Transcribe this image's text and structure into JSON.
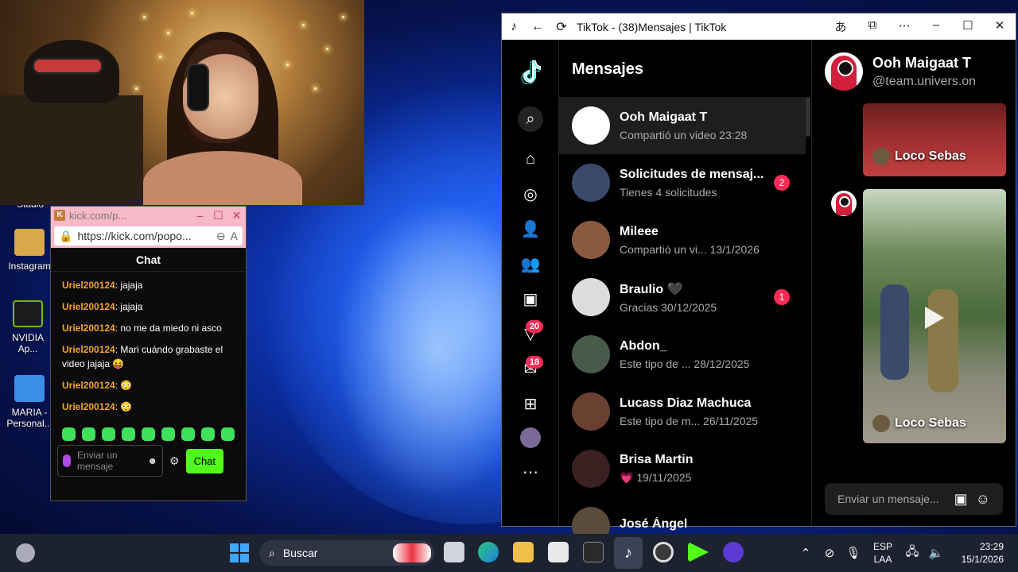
{
  "desktop": {
    "icons": [
      {
        "label": "Studio"
      },
      {
        "label": "Instagram"
      },
      {
        "label": "NVIDIA Ap..."
      },
      {
        "label": "MARIA - Personal..."
      }
    ]
  },
  "kick": {
    "tab_title": "kick.com/p...",
    "url": "https://kick.com/popo...",
    "chat_heading": "Chat",
    "messages": [
      {
        "user": "Uriel200124",
        "text": ": jajaja"
      },
      {
        "user": "Uriel200124",
        "text": ": jajaja"
      },
      {
        "user": "Uriel200124",
        "text": ": no me da miedo ni asco"
      },
      {
        "user": "Uriel200124",
        "text": ": Mari cuándo grabaste el video jajaja 😝"
      },
      {
        "user": "Uriel200124",
        "text": ": 😳"
      },
      {
        "user": "Uriel200124",
        "text": ": 😳"
      }
    ],
    "input_placeholder": "Enviar un mensaje",
    "send_label": "Chat"
  },
  "tiktok": {
    "window_title": "TikTok - (38)Mensajes | TikTok",
    "heading": "Mensajes",
    "rail_badges": {
      "activity": "20",
      "inbox": "18"
    },
    "conversations": [
      {
        "name": "Ooh Maigaat T",
        "sub": "Compartió un video 23:28",
        "count": "",
        "avatar_color": "#ffffff"
      },
      {
        "name": "Solicitudes de mensaj...",
        "sub": "Tienes 4 solicitudes",
        "count": "2",
        "avatar_color": "#3b4a6b"
      },
      {
        "name": "Mileee",
        "sub": "Compartió un vi...  13/1/2026",
        "count": "",
        "avatar_color": "#8a5a40"
      },
      {
        "name": "Braulio 🖤",
        "sub": "Gracias 30/12/2025",
        "count": "1",
        "avatar_color": "#dcdcdc"
      },
      {
        "name": "Abdon_",
        "sub": "Este tipo de ...    28/12/2025",
        "count": "",
        "avatar_color": "#4a5a4a"
      },
      {
        "name": "Lucass Diaz Machuca",
        "sub": "Este tipo de m... 26/11/2025",
        "count": "",
        "avatar_color": "#6a4030"
      },
      {
        "name": "Brisa Martin",
        "sub": "💗 19/11/2025",
        "count": "",
        "avatar_color": "#3a2020"
      },
      {
        "name": "José Ángel",
        "sub": "",
        "count": "",
        "avatar_color": "#5a4a3a"
      }
    ],
    "chat": {
      "name": "Ooh Maigaat T",
      "handle": "@team.univers.on",
      "videos": [
        {
          "caption": "Loco Sebas"
        },
        {
          "caption": "Loco Sebas"
        }
      ],
      "input_placeholder": "Enviar un mensaje..."
    }
  },
  "taskbar": {
    "search_label": "Buscar",
    "lang_top": "ESP",
    "lang_bottom": "LAA",
    "time": "23:29",
    "date": "15/1/2026"
  }
}
